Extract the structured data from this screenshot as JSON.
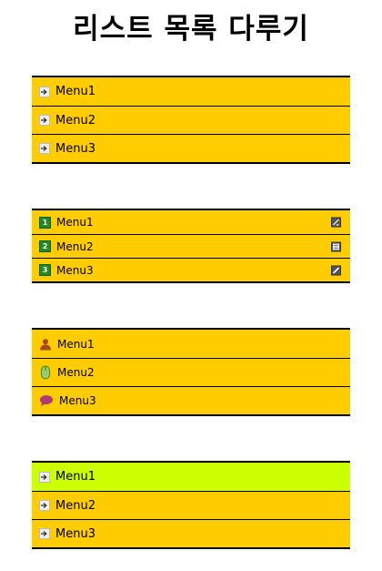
{
  "title": "리스트 목록 다루기",
  "list_a": [
    "Menu1",
    "Menu2",
    "Menu3"
  ],
  "list_b": [
    {
      "number": "1",
      "label": "Menu1",
      "right_icon": "edit-icon"
    },
    {
      "number": "2",
      "label": "Menu2",
      "right_icon": "grid-icon"
    },
    {
      "number": "3",
      "label": "Menu3",
      "right_icon": "pencil-icon"
    }
  ],
  "list_c": [
    {
      "label": "Menu1",
      "icon": "user-icon"
    },
    {
      "label": "Menu2",
      "icon": "mouse-icon"
    },
    {
      "label": "Menu3",
      "icon": "speech-bubble-icon"
    }
  ],
  "list_d": [
    {
      "label": "Menu1",
      "active": true
    },
    {
      "label": "Menu2",
      "active": false
    },
    {
      "label": "Menu3",
      "active": false
    }
  ],
  "colors": {
    "list_bg": "#ffcc00",
    "active_bg": "#ccff00",
    "badge_green": "#228b22"
  }
}
